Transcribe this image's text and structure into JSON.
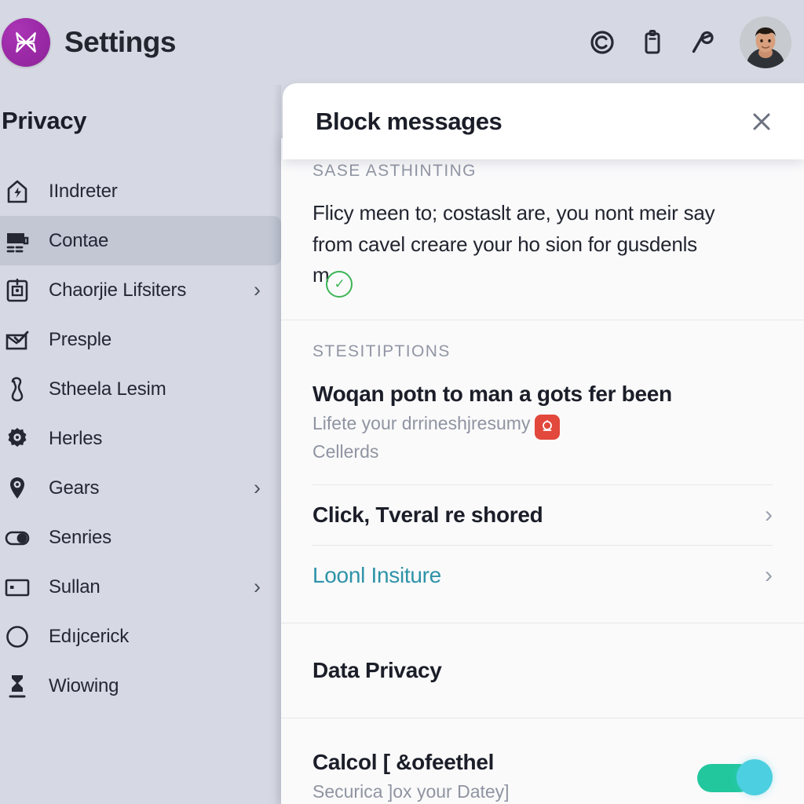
{
  "app": {
    "title": "Settings",
    "logo_icon": "butterfly-logo-icon",
    "logo_color": "#9c2ba8"
  },
  "topbar": {
    "icons": [
      {
        "name": "copyright-icon",
        "label": "C"
      },
      {
        "name": "clipboard-icon",
        "label": ""
      },
      {
        "name": "pickaxe-icon",
        "label": ""
      }
    ],
    "avatar_name": "user-avatar"
  },
  "sidebar": {
    "heading": "Privacy",
    "items": [
      {
        "label": "IIndreter",
        "icon": "house-bolt-icon",
        "chevron": false,
        "selected": false
      },
      {
        "label": "Contae",
        "icon": "monitor-icon",
        "chevron": false,
        "selected": true
      },
      {
        "label": "Chaorjie Lifsiters",
        "icon": "clipboard-icon",
        "chevron": true,
        "selected": false
      },
      {
        "label": "Presple",
        "icon": "envelope-check-icon",
        "chevron": false,
        "selected": false
      },
      {
        "label": "Stheela Lesim",
        "icon": "person-icon",
        "chevron": false,
        "selected": false
      },
      {
        "label": "Herles",
        "icon": "gear-icon",
        "chevron": false,
        "selected": false
      },
      {
        "label": "Gears",
        "icon": "location-pin-icon",
        "chevron": true,
        "selected": false
      },
      {
        "label": "Senries",
        "icon": "toggle-icon",
        "chevron": false,
        "selected": false
      },
      {
        "label": "Sullan",
        "icon": "card-icon",
        "chevron": true,
        "selected": false
      },
      {
        "label": "Edıjcerick",
        "icon": "circle-icon",
        "chevron": false,
        "selected": false
      },
      {
        "label": "Wiowing",
        "icon": "figure-icon",
        "chevron": false,
        "selected": false
      }
    ],
    "chevron_glyph": "›"
  },
  "modal": {
    "title": "Block messages",
    "close_icon": "close-icon"
  },
  "content": {
    "kicker": "SASE ASTHINTING",
    "body_line1": "Flicy meen to; costaslt are, you nont meir say",
    "body_line2": "from cavel creare your ho sion for gusdenls",
    "body_line3": "m",
    "body_badge_icon": "green-check-circle-icon",
    "sections": [
      {
        "kicker": "STESITIPTIONS",
        "item_title": "Woqan potn to man a gots fer been",
        "item_sub_line1": "Lifete your drrineshjresumy",
        "item_sub_badge_icon": "red-app-badge-icon",
        "item_sub_line2": "Cellerds",
        "rows": [
          {
            "label": "Click, Tveral re shored",
            "style": "default",
            "chevron": true
          },
          {
            "label": "Loonl Insiture",
            "style": "link",
            "chevron": true
          }
        ]
      }
    ],
    "data_privacy_title": "Data Privacy",
    "toggle_item": {
      "title": "Calcol [ &ofeethel",
      "subtitle": "Securica ]ox your Datey]",
      "enabled": true,
      "track_color": "#22c79e",
      "knob_color": "#4ccfe0"
    },
    "chevron_glyph": "›"
  }
}
